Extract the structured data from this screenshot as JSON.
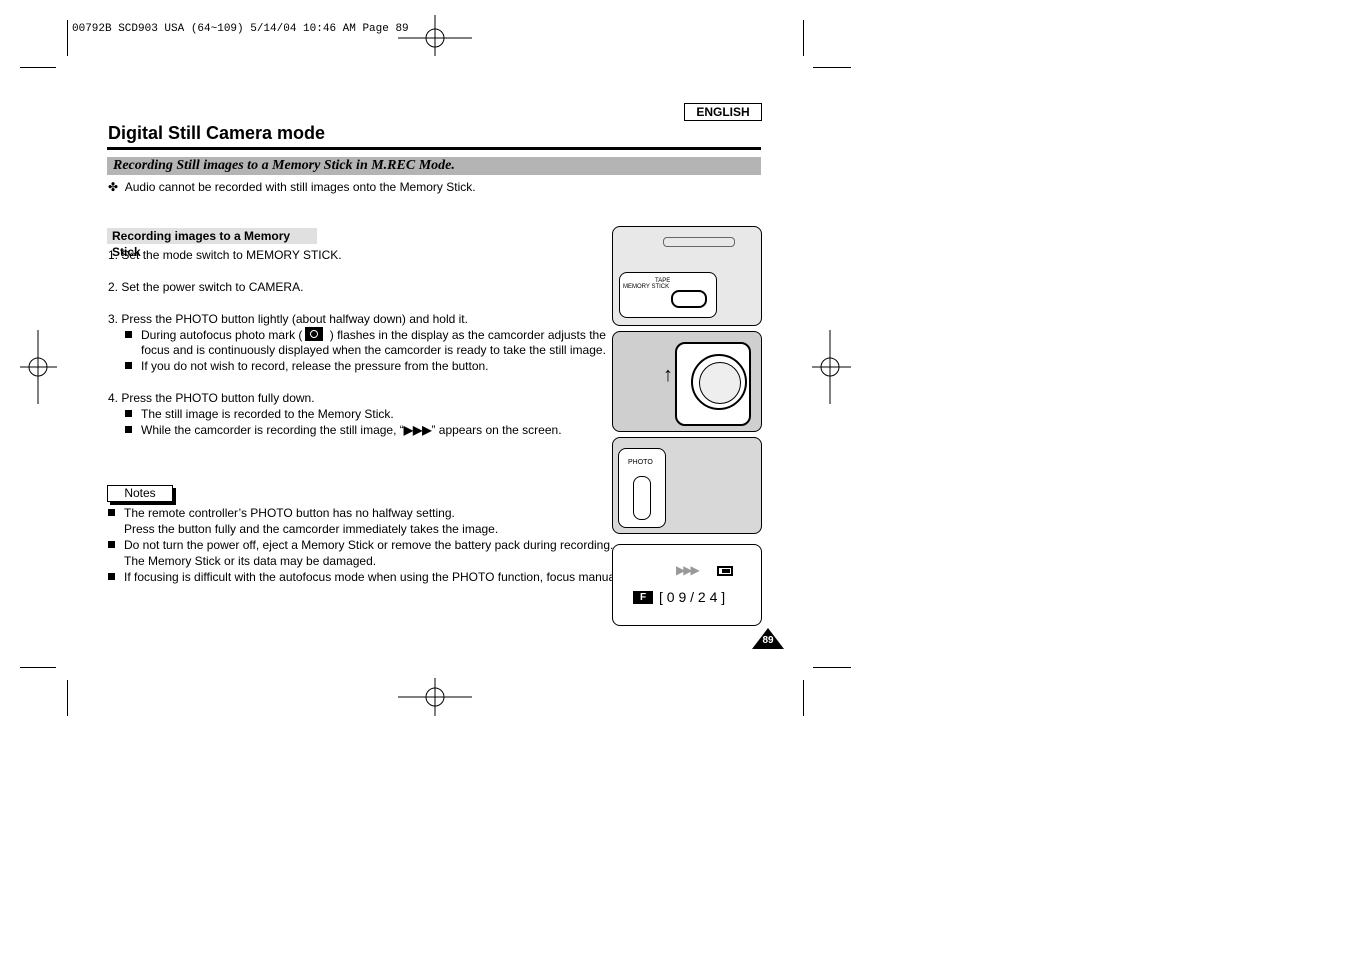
{
  "print_header": "00792B SCD903 USA (64~109)   5/14/04 10:46 AM  Page 89",
  "language_badge": "ENGLISH",
  "page_title": "Digital Still Camera mode",
  "section_bar": "Recording Still images to a Memory Stick in M.REC Mode.",
  "intro_note": {
    "symbol": "✤",
    "text": "Audio cannot be recorded with still images onto the Memory Stick."
  },
  "subsection": "Recording images to a Memory Stick",
  "steps": [
    {
      "text": "1.  Set the mode switch to MEMORY STICK.",
      "bullets": []
    },
    {
      "text": "2.  Set the power switch to CAMERA.",
      "bullets": []
    },
    {
      "text": "3.  Press the PHOTO button lightly (about halfway down) and hold it.",
      "bullets": [
        "During autofocus photo mark (",
        "  ) flashes in the display as the camcorder adjusts the",
        "focus and is continuously displayed when the camcorder is ready to take the still image.",
        "If you do not wish to record, release the pressure from the button."
      ]
    },
    {
      "text": "4.  Press the PHOTO button fully down.",
      "bullets": [
        "The still image is recorded to the Memory Stick.",
        "While the camcorder is recording the still image, “",
        "” appears on the screen."
      ]
    }
  ],
  "notes_label": "Notes",
  "notes": [
    [
      "The remote controller’s PHOTO button has no halfway setting.",
      "Press the button fully and the camcorder immediately takes the image."
    ],
    [
      "Do not turn the power off, eject a Memory Stick or remove the battery pack during recording.",
      "The Memory Stick or its data may be damaged."
    ],
    [
      "If focusing is difficult with the autofocus mode when using the PHOTO function, focus manually."
    ]
  ],
  "figures": {
    "switch_labels": [
      "TAPE",
      "MEMORY STICK"
    ],
    "photo_label": "PHOTO",
    "display": {
      "mode": "F",
      "counter": "[ 0 9 / 2 4 ]"
    }
  },
  "page_number": "89"
}
